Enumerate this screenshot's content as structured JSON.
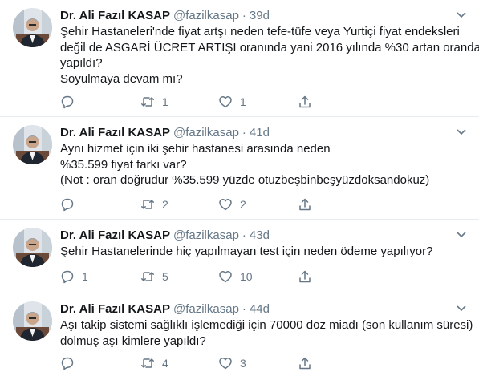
{
  "tweets": [
    {
      "name": "Dr. Ali Fazıl KASAP",
      "handle": "@fazilkasap",
      "separator": "·",
      "time": "39d",
      "lines": [
        "Şehir Hastaneleri'nde fiyat artşı neden tefe-tüfe veya Yurtiçi fiyat endeksleri",
        "değil de ASGARİ ÜCRET ARTIŞI oranında yani 2016 yılında %30 artan oranda",
        "yapıldı?",
        "Soyulmaya devam mı?"
      ],
      "replies": "",
      "retweets": "1",
      "likes": "1"
    },
    {
      "name": "Dr. Ali Fazıl KASAP",
      "handle": "@fazilkasap",
      "separator": "·",
      "time": "41d",
      "lines": [
        "Aynı hizmet için iki şehir hastanesi arasında neden",
        "%35.599 fiyat farkı var?",
        "(Not : oran doğrudur %35.599 yüzde otuzbeşbinbeşyüzdoksandokuz)"
      ],
      "replies": "",
      "retweets": "2",
      "likes": "2"
    },
    {
      "name": "Dr. Ali Fazıl KASAP",
      "handle": "@fazilkasap",
      "separator": "·",
      "time": "43d",
      "lines": [
        "Şehir Hastanelerinde hiç yapılmayan test için neden ödeme yapılıyor?"
      ],
      "replies": "1",
      "retweets": "5",
      "likes": "10"
    },
    {
      "name": "Dr. Ali Fazıl KASAP",
      "handle": "@fazilkasap",
      "separator": "·",
      "time": "44d",
      "lines": [
        "Aşı takip sistemi sağlıklı işlemediği için 70000 doz miadı (son kullanım süresi)",
        "dolmuş aşı kimlere yapıldı?"
      ],
      "replies": "",
      "retweets": "4",
      "likes": "3"
    }
  ],
  "icons": {
    "reply": "reply-icon",
    "retweet": "retweet-icon",
    "like": "heart-icon",
    "share": "share-icon",
    "more": "chevron-down-icon"
  },
  "colors": {
    "text": "#14171a",
    "secondary": "#657786",
    "divider": "#e6ecf0"
  }
}
